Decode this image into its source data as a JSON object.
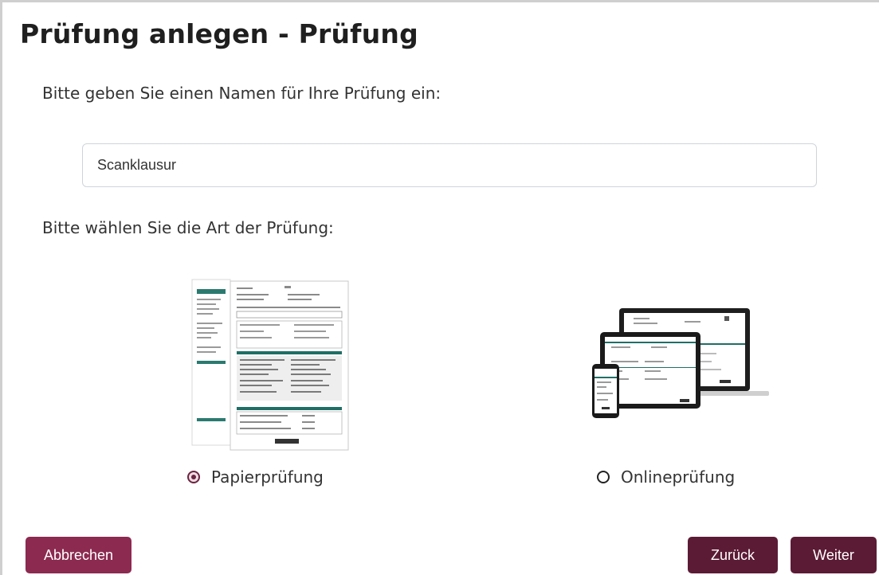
{
  "header": {
    "title": "Prüfung anlegen - Prüfung"
  },
  "form": {
    "name_prompt": "Bitte geben Sie einen Namen für Ihre Prüfung ein:",
    "name_value": "Scanklausur",
    "type_prompt": "Bitte wählen Sie die Art der Prüfung:"
  },
  "exam_types": {
    "paper": {
      "label": "Papierprüfung",
      "selected": true,
      "icon": "paper-exam-icon"
    },
    "online": {
      "label": "Onlineprüfung",
      "selected": false,
      "icon": "devices-icon"
    }
  },
  "footer": {
    "cancel_label": "Abbrechen",
    "back_label": "Zurück",
    "next_label": "Weiter"
  },
  "colors": {
    "accent": "#8c2a50",
    "accent_dark": "#5c1b35",
    "teal": "#1f6f66"
  }
}
